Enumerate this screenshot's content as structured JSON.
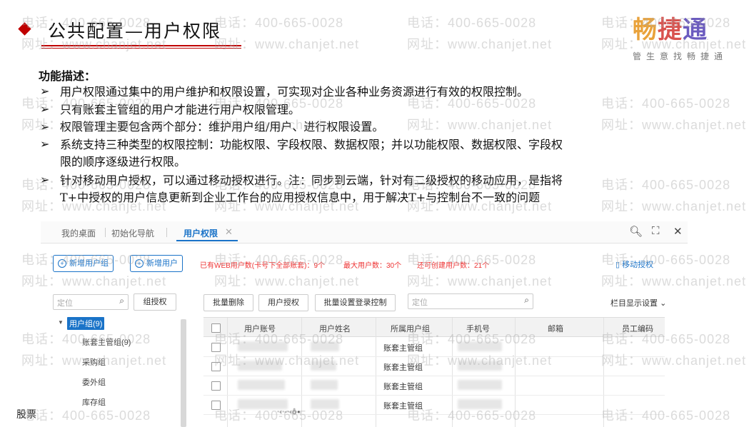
{
  "header": {
    "title": "公共配置—用户权限",
    "logo_chars": [
      "畅",
      "捷",
      "通"
    ],
    "logo_tagline": "管生意找畅捷通"
  },
  "watermark": {
    "phone": "电话：400-665-0028",
    "website": "网址：www.chanjet.net"
  },
  "description": {
    "heading": "功能描述：",
    "bullet_symbol": "➢",
    "lines": [
      " 用户权限通过集中的用户维护和权限设置，可实现对企业各种业务资源进行有效的权限控制。",
      "只有账套主管组的用户才能进行用户权限管理。",
      "权限管理主要包含两个部分：维护用户组/用户、进行权限设置。",
      "系统支持三种类型的权限控制：功能权限、字段权限、数据权限；并以功能权限、数据权限、字段权",
      "限的顺序逐级进行权限。",
      "针对移动用户授权，可以通过移动授权进行。注：同步到云端，针对有二级授权的移动应用，是指将",
      "T+中授权的用户信息更新到企业工作台的应用授权信息中，用于解决T+与控制台不一致的问题"
    ]
  },
  "app": {
    "tabs": [
      "我的桌面",
      "初始化导航",
      "用户权限"
    ],
    "active_tab": "用户权限",
    "toolbar": {
      "new_group": "新增用户组",
      "new_user": "新增用户",
      "web_users": "已有WEB用户数(卡号下全部账套)：9个",
      "max_users": "最大用户数：30个",
      "remaining": "还可创建用户数：21个",
      "mobile_auth": "移动授权"
    },
    "left": {
      "search_placeholder": "定位",
      "group_auth": "组授权",
      "tree_root": "用户组(9)",
      "tree_items": [
        "账套主管组(9)",
        "采购组",
        "委外组",
        "库存组"
      ]
    },
    "right": {
      "batch_delete": "批量删除",
      "user_auth": "用户授权",
      "batch_login": "批量设置登录控制",
      "search_placeholder": "定位",
      "column_settings": "栏目显示设置",
      "columns": [
        "用户账号",
        "用户姓名",
        "所属用户组",
        "手机号",
        "邮箱",
        "员工编码"
      ],
      "rows": [
        {
          "group": "账套主管组"
        },
        {
          "group": "账套主管组"
        },
        {
          "group": "账套主管组"
        },
        {
          "group": "账套主管组"
        }
      ]
    }
  },
  "footer": {
    "label": "股票",
    "blurred": "·‹·-·‹ô∙"
  },
  "colors": {
    "accent_red": "#c00000",
    "app_blue": "#1a73c8",
    "stat_red": "#ee3333"
  }
}
